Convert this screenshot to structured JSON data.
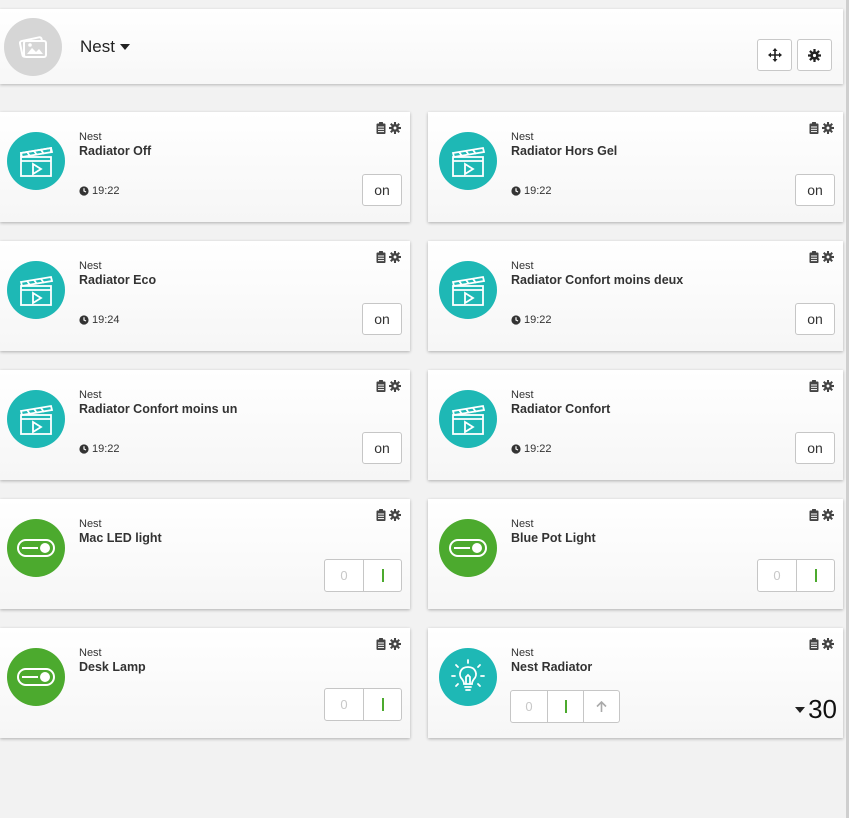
{
  "header": {
    "title": "Nest",
    "avatar_icon": "image-placeholder-icon",
    "move_icon": "move-arrows-icon",
    "settings_icon": "gear-icon"
  },
  "tiles": [
    {
      "room": "Nest",
      "name": "Radiator Off",
      "time": "19:22",
      "action": "on",
      "icon": "scene-clapper-icon"
    },
    {
      "room": "Nest",
      "name": "Radiator Hors Gel",
      "time": "19:22",
      "action": "on",
      "icon": "scene-clapper-icon"
    },
    {
      "room": "Nest",
      "name": "Radiator Eco",
      "time": "19:24",
      "action": "on",
      "icon": "scene-clapper-icon"
    },
    {
      "room": "Nest",
      "name": "Radiator Confort moins deux",
      "time": "19:22",
      "action": "on",
      "icon": "scene-clapper-icon"
    },
    {
      "room": "Nest",
      "name": "Radiator Confort moins un",
      "time": "19:22",
      "action": "on",
      "icon": "scene-clapper-icon"
    },
    {
      "room": "Nest",
      "name": "Radiator Confort",
      "time": "19:22",
      "action": "on",
      "icon": "scene-clapper-icon"
    },
    {
      "room": "Nest",
      "name": "Mac LED light",
      "off_label": "0",
      "icon": "switch-toggle-icon"
    },
    {
      "room": "Nest",
      "name": "Blue Pot Light",
      "off_label": "0",
      "icon": "switch-toggle-icon"
    },
    {
      "room": "Nest",
      "name": "Desk Lamp",
      "off_label": "0",
      "icon": "switch-toggle-icon"
    },
    {
      "room": "Nest",
      "name": "Nest Radiator",
      "off_label": "0",
      "temperature": "30",
      "icon": "light-bulb-icon"
    }
  ],
  "colors": {
    "teal": "#1eb8b5",
    "green": "#4caa2e",
    "background": "#f2f2f2"
  }
}
